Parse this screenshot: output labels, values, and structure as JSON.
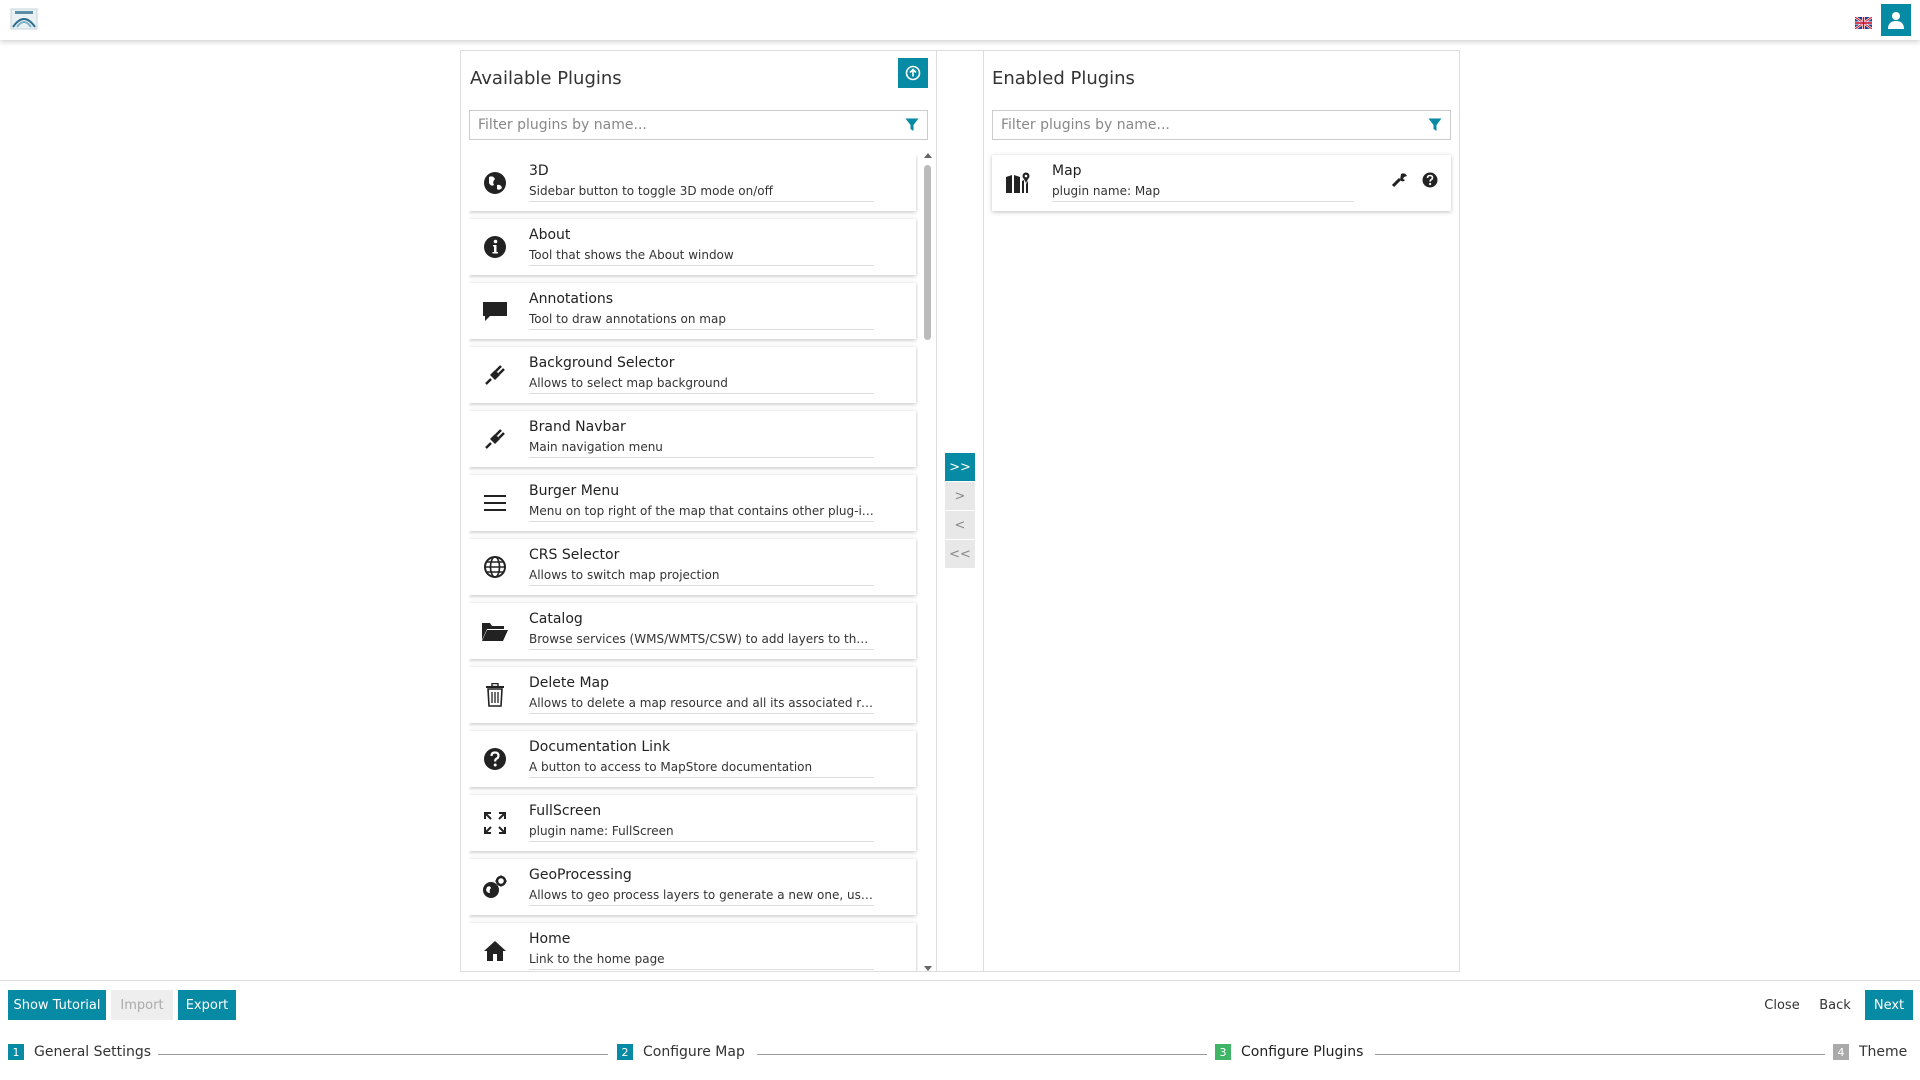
{
  "header": {
    "flag_icon": "uk-flag-icon",
    "user_icon": "user-icon",
    "accent": "#078aa3"
  },
  "available": {
    "title": "Available Plugins",
    "filter_placeholder": "Filter plugins by name...",
    "plugins": [
      {
        "title": "3D",
        "desc": "Sidebar button to toggle 3D mode on/off",
        "icon": "globe-icon"
      },
      {
        "title": "About",
        "desc": "Tool that shows the About window",
        "icon": "info-icon"
      },
      {
        "title": "Annotations",
        "desc": "Tool to draw annotations on map",
        "icon": "comment-icon"
      },
      {
        "title": "Background Selector",
        "desc": "Allows to select map background",
        "icon": "plug-icon"
      },
      {
        "title": "Brand Navbar",
        "desc": "Main navigation menu",
        "icon": "plug-icon"
      },
      {
        "title": "Burger Menu",
        "desc": "Menu on top right of the map that contains other plug-ins",
        "icon": "menu-icon"
      },
      {
        "title": "CRS Selector",
        "desc": "Allows to switch map projection",
        "icon": "globe-grid-icon"
      },
      {
        "title": "Catalog",
        "desc": "Browse services (WMS/WMTS/CSW) to add layers to the map",
        "icon": "folder-icon"
      },
      {
        "title": "Delete Map",
        "desc": "Allows to delete a map resource and all its associated resou...",
        "icon": "trash-icon"
      },
      {
        "title": "Documentation Link",
        "desc": "A button to access to MapStore documentation",
        "icon": "question-icon"
      },
      {
        "title": "FullScreen",
        "desc": "plugin name: FullScreen",
        "icon": "fullscreen-icon"
      },
      {
        "title": "GeoProcessing",
        "desc": "Allows to geo process layers to generate a new one, using w...",
        "icon": "geoprocess-icon"
      },
      {
        "title": "Home",
        "desc": "Link to the home page",
        "icon": "home-icon"
      }
    ]
  },
  "transfer": {
    "all_right": ">>",
    "right": ">",
    "left": "<",
    "all_left": "<<"
  },
  "enabled": {
    "title": "Enabled Plugins",
    "filter_placeholder": "Filter plugins by name...",
    "plugins": [
      {
        "title": "Map",
        "desc": "plugin name: Map",
        "icon": "map-icon"
      }
    ]
  },
  "footer": {
    "show_tutorial": "Show Tutorial",
    "import": "Import",
    "export": "Export",
    "close": "Close",
    "back": "Back",
    "next": "Next"
  },
  "steps": [
    {
      "num": "1",
      "label": "General Settings"
    },
    {
      "num": "2",
      "label": "Configure Map"
    },
    {
      "num": "3",
      "label": "Configure Plugins"
    },
    {
      "num": "4",
      "label": "Theme"
    }
  ]
}
